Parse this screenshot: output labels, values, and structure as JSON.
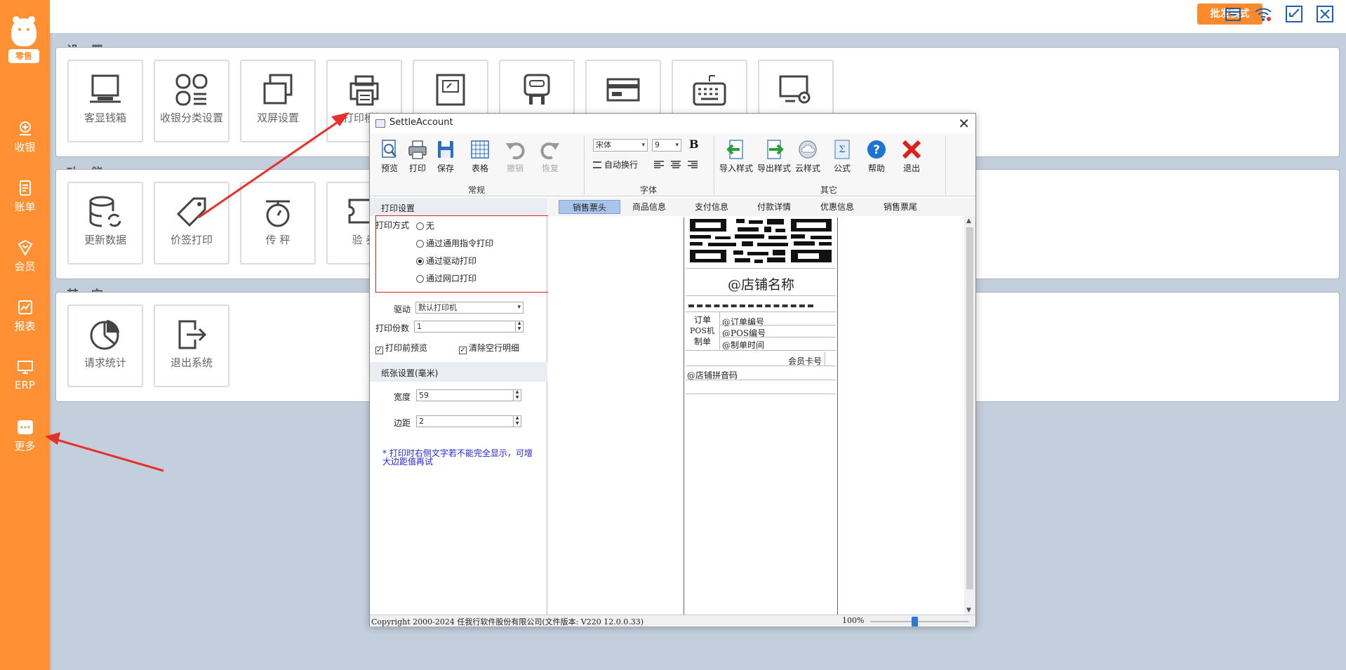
{
  "sidebar": {
    "logo_text": "零售",
    "items": [
      {
        "label": "收银",
        "icon": "cashier-icon"
      },
      {
        "label": "账单",
        "icon": "bill-icon"
      },
      {
        "label": "会员",
        "icon": "member-icon"
      },
      {
        "label": "报表",
        "icon": "report-icon"
      },
      {
        "label": "ERP",
        "icon": "erp-monitor-icon"
      },
      {
        "label": "更多",
        "icon": "more-icon"
      }
    ]
  },
  "topbar": {
    "batch_mode_label": "批发模式",
    "icons": [
      "store-icon",
      "wifi-icon",
      "shrink-icon",
      "close-icon"
    ]
  },
  "sections": {
    "settings": {
      "title": "设 置",
      "tiles": [
        "客显钱箱",
        "收银分类设置",
        "双屏设置",
        "打印模板",
        "",
        "",
        "",
        "",
        ""
      ]
    },
    "functions": {
      "title": "功 能",
      "tiles": [
        "更新数据",
        "价签打印",
        "传 秤",
        "验 券"
      ]
    },
    "others": {
      "title": "其 它",
      "tiles": [
        "请求统计",
        "退出系统"
      ]
    }
  },
  "dialog": {
    "title": "SettleAccount",
    "ribbon": {
      "general_buttons": [
        "预览",
        "打印",
        "保存",
        "表格",
        "撤销",
        "恢复"
      ],
      "general_group": "常规",
      "font_name": "宋体",
      "font_size": "9",
      "bold_label": "B",
      "wrap_label": "自动换行",
      "font_group": "字体",
      "other_buttons": [
        "导入样式",
        "导出样式",
        "云样式",
        "公式",
        "帮助",
        "退出"
      ],
      "other_group": "其它"
    },
    "print_settings": {
      "header": "打印设置",
      "method_label": "打印方式",
      "options": [
        "无",
        "通过通用指令打印",
        "通过驱动打印",
        "通过网口打印"
      ],
      "selected_option": "通过驱动打印",
      "driver_label": "驱动",
      "driver_value": "默认打印机",
      "copies_label": "打印份数",
      "copies_value": "1",
      "preview_before_print": "打印前预览",
      "clear_empty_rows": "清除空行明细"
    },
    "paper_settings": {
      "header": "纸张设置(毫米)",
      "width_label": "宽度",
      "width_value": "59",
      "margin_label": "边距",
      "margin_value": "2",
      "note": "* 打印时右侧文字若不能完全显示，可增大边距值再试"
    },
    "tabs": [
      "销售票头",
      "商品信息",
      "支付信息",
      "付款详情",
      "优惠信息",
      "销售票尾"
    ],
    "active_tab": "销售票头",
    "receipt": {
      "store_name": "@店铺名称",
      "rows": [
        {
          "label": "订单",
          "value": "@订单编号"
        },
        {
          "label": "POS机",
          "value": "@POS编号"
        },
        {
          "label": "制单",
          "value": "@制单时间"
        }
      ],
      "member_card": "会员卡号",
      "store_pinyin": "@店铺拼音码"
    },
    "status": {
      "copyright": "Copyright 2000-2024 任我行软件股份有限公司(文件版本: V220 12.0.0.33)",
      "zoom": "100%",
      "zoom_level": 0.45
    }
  },
  "colors": {
    "accent": "#ff9134",
    "batch_button": "#ff8a2b",
    "background": "#c3cfdc",
    "annotation_red": "#e02020"
  }
}
